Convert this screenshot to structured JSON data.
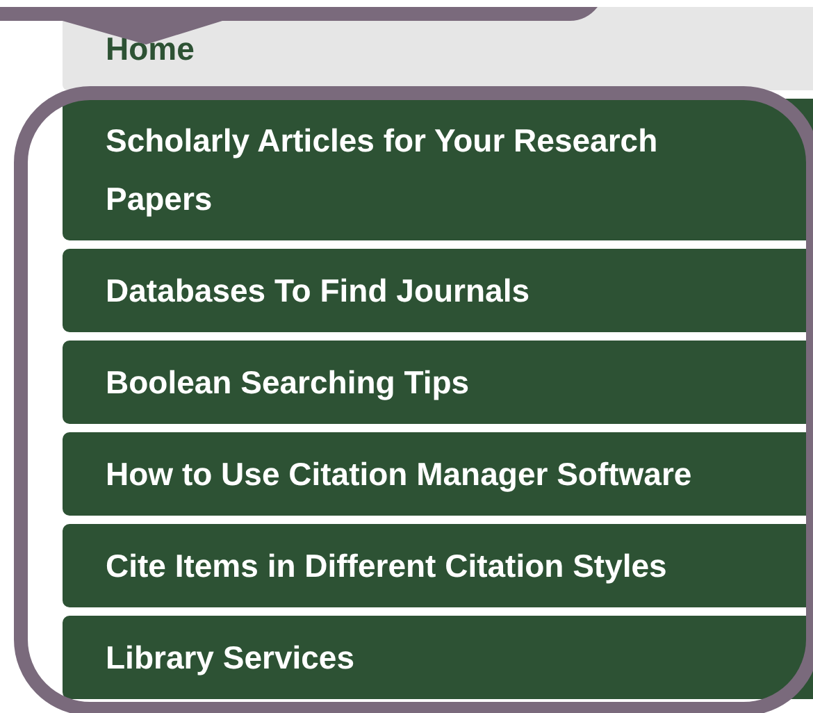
{
  "home_link": {
    "label": "Home"
  },
  "nav_items": [
    {
      "label": "Scholarly Articles for Your Research Papers"
    },
    {
      "label": "Databases To Find Journals"
    },
    {
      "label": "Boolean Searching Tips"
    },
    {
      "label": "How to Use Citation Manager Software"
    },
    {
      "label": "Cite Items in Different Citation Styles"
    },
    {
      "label": "Library Services"
    }
  ]
}
